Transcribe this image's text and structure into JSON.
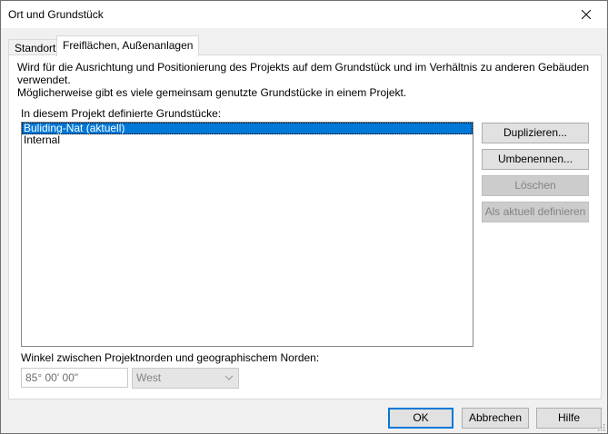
{
  "window": {
    "title": "Ort und Grundstück"
  },
  "tabs": [
    {
      "label": "Standort",
      "active": false
    },
    {
      "label": "Freiflächen, Außenanlagen",
      "active": true
    }
  ],
  "panel": {
    "description_line1": "Wird für die Ausrichtung und Positionierung des Projekts auf dem Grundstück und im Verhältnis zu anderen Gebäuden verwendet.",
    "description_line2": "Möglicherweise gibt es viele gemeinsam genutzte Grundstücke in einem Projekt.",
    "list_label": "In diesem Projekt definierte Grundstücke:",
    "sites": [
      {
        "label": "Buliding-Nat (aktuell)",
        "selected": true
      },
      {
        "label": "Internal",
        "selected": false
      }
    ],
    "buttons": {
      "duplicate": "Duplizieren...",
      "rename": "Umbenennen...",
      "delete": "Löschen",
      "set_current": "Als aktuell definieren"
    },
    "angle_label": "Winkel zwischen Projektnorden und geographischem Norden:",
    "angle_value": "85° 00' 00\"",
    "direction_value": "West"
  },
  "footer": {
    "ok": "OK",
    "cancel": "Abbrechen",
    "help": "Hilfe"
  },
  "colors": {
    "selection": "#0078d7",
    "default_button_border": "#0078d7"
  }
}
